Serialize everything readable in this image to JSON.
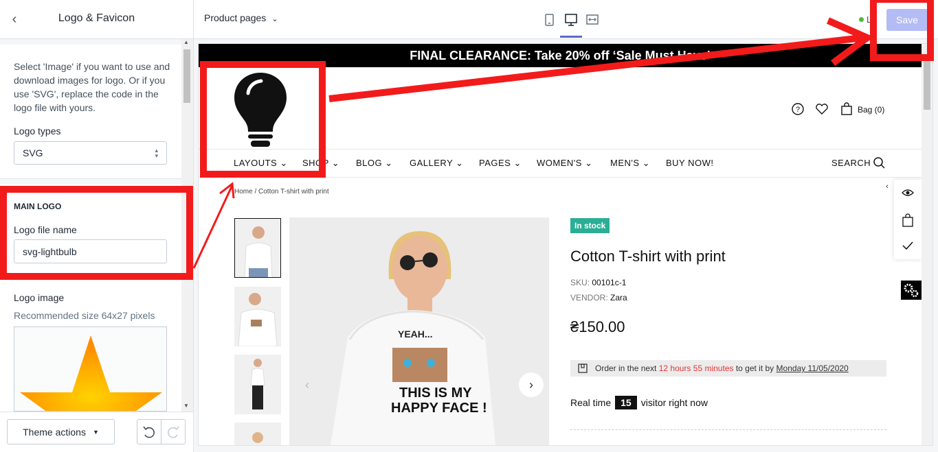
{
  "sidebar": {
    "title": "Logo & Favicon",
    "intro": "Select 'Image' if you want to use and download images for logo. Or if you use 'SVG', replace the code in the logo file with yours.",
    "logo_types_label": "Logo types",
    "logo_types_value": "SVG",
    "main_logo_heading": "MAIN LOGO",
    "logo_file_label": "Logo file name",
    "logo_file_value": "svg-lightbulb",
    "logo_image_label": "Logo image",
    "logo_image_hint": "Recommended size 64x27 pixels",
    "theme_actions": "Theme actions"
  },
  "topbar": {
    "page_select": "Product pages",
    "live_label": "L",
    "save": "Save",
    "device_icons": [
      "mobile-icon",
      "desktop-icon",
      "fullscreen-icon"
    ]
  },
  "store": {
    "announcement": "FINAL CLEARANCE: Take 20% off ‘Sale Must Have’",
    "bag": "Bag (0)",
    "nav": [
      "LAYOUTS",
      "SHOP",
      "BLOG",
      "GALLERY",
      "PAGES",
      "WOMEN'S",
      "MEN'S",
      "BUY NOW!"
    ],
    "search": "SEARCH",
    "breadcrumb": "Home  /  Cotton T-shirt with print",
    "badge": "In stock",
    "product_title": "Cotton T-shirt with print",
    "sku_label": "SKU:",
    "sku": "00101c-1",
    "vendor_label": "VENDOR:",
    "vendor": "Zara",
    "price": "₴150.00",
    "order_prefix": "Order in the next",
    "order_time": "12 hours 55 minutes",
    "order_mid": "to get it by",
    "order_date": "Monday 11/05/2020",
    "visitors_prefix": "Real time",
    "visitors_count": "15",
    "visitors_suffix": "visitor right now",
    "shirt_text_1": "YEAH...",
    "shirt_text_2": "THIS IS MY",
    "shirt_text_3": "HAPPY FACE !"
  },
  "colors": {
    "annotation_red": "#f21b1b",
    "accent": "#5c6ac4",
    "save_button": "#b3bcf5",
    "in_stock": "#2bae95",
    "order_time": "#e83434"
  }
}
